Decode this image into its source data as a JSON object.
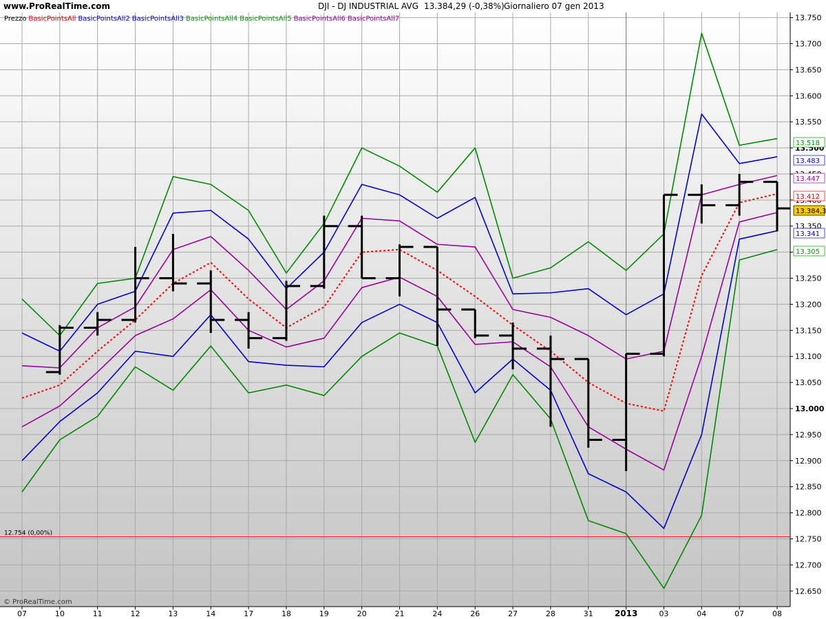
{
  "header": {
    "site": "www.ProRealTime.com",
    "instrument": "DJI - DJ INDUSTRIAL AVG",
    "price_change": "13.384,29 (-0,38%)",
    "period_date": "Giornaliero  07 gen 2013"
  },
  "watermark": "© ProRealTime.com",
  "legend_items": [
    {
      "text": "Prezzo",
      "color": "#000000"
    },
    {
      "text": "BasicPointsAll",
      "color": "#dd0000"
    },
    {
      "text": "BasicPointsAll2",
      "color": "#0000cc"
    },
    {
      "text": "BasicPointsAll3",
      "color": "#0000cc"
    },
    {
      "text": "BasicPointsAll4",
      "color": "#009900"
    },
    {
      "text": "BasicPointsAll5",
      "color": "#009900"
    },
    {
      "text": "BasicPointsAll6",
      "color": "#990099"
    },
    {
      "text": "BasicPointsAll7",
      "color": "#990099"
    }
  ],
  "chart_data": {
    "type": "line",
    "price_style": "ohlc-bars",
    "x_ticks": [
      "07",
      "10",
      "11",
      "12",
      "13",
      "14",
      "17",
      "18",
      "19",
      "20",
      "21",
      "24",
      "26",
      "27",
      "28",
      "31",
      "2013",
      "03",
      "04",
      "07",
      "08"
    ],
    "ylim": [
      12620,
      13760
    ],
    "y_ticks": [
      "13.750",
      "13.700",
      "13.650",
      "13.600",
      "13.550",
      "13.500",
      "13.450",
      "13.400",
      "13.350",
      "13.300",
      "13.250",
      "13.200",
      "13.150",
      "13.100",
      "13.050",
      "13.000",
      "12.950",
      "12.900",
      "12.850",
      "12.800",
      "12.750",
      "12.700",
      "12.650"
    ],
    "y_tick_values": [
      13750,
      13700,
      13650,
      13600,
      13550,
      13500,
      13450,
      13400,
      13350,
      13300,
      13250,
      13200,
      13150,
      13100,
      13050,
      13000,
      12950,
      12900,
      12850,
      12800,
      12750,
      12700,
      12650
    ],
    "bold_y_ticks": [
      "13.500",
      "13.000"
    ],
    "grid": true,
    "reference_line": {
      "value": 12754,
      "label": "12.754 (0,00%)",
      "color": "#ff0000"
    },
    "ohlc": [
      {
        "x": 1,
        "o": 13070,
        "h": 13160,
        "l": 13065,
        "c": 13155
      },
      {
        "x": 2,
        "o": 13155,
        "h": 13185,
        "l": 13140,
        "c": 13170
      },
      {
        "x": 3,
        "o": 13170,
        "h": 13310,
        "l": 13165,
        "c": 13250
      },
      {
        "x": 4,
        "o": 13250,
        "h": 13335,
        "l": 13225,
        "c": 13240
      },
      {
        "x": 5,
        "o": 13240,
        "h": 13265,
        "l": 13145,
        "c": 13170
      },
      {
        "x": 6,
        "o": 13170,
        "h": 13185,
        "l": 13115,
        "c": 13135
      },
      {
        "x": 7,
        "o": 13135,
        "h": 13245,
        "l": 13130,
        "c": 13235
      },
      {
        "x": 8,
        "o": 13235,
        "h": 13370,
        "l": 13230,
        "c": 13350
      },
      {
        "x": 9,
        "o": 13350,
        "h": 13370,
        "l": 13250,
        "c": 13250
      },
      {
        "x": 10,
        "o": 13250,
        "h": 13315,
        "l": 13215,
        "c": 13310
      },
      {
        "x": 11,
        "o": 13310,
        "h": 13310,
        "l": 13120,
        "c": 13190
      },
      {
        "x": 12,
        "o": 13190,
        "h": 13190,
        "l": 13135,
        "c": 13140
      },
      {
        "x": 13,
        "o": 13140,
        "h": 13165,
        "l": 13075,
        "c": 13115
      },
      {
        "x": 14,
        "o": 13115,
        "h": 13140,
        "l": 12965,
        "c": 13095
      },
      {
        "x": 15,
        "o": 13095,
        "h": 13095,
        "l": 12925,
        "c": 12940
      },
      {
        "x": 16,
        "o": 12940,
        "h": 13105,
        "l": 12880,
        "c": 13105
      },
      {
        "x": 17,
        "o": 13105,
        "h": 13410,
        "l": 13100,
        "c": 13410
      },
      {
        "x": 18,
        "o": 13410,
        "h": 13430,
        "l": 13355,
        "c": 13390
      },
      {
        "x": 19,
        "o": 13390,
        "h": 13450,
        "l": 13370,
        "c": 13435
      },
      {
        "x": 20,
        "o": 13435,
        "h": 13435,
        "l": 13340,
        "c": 13384
      }
    ],
    "series": [
      {
        "key": "BasicPointsAll",
        "color": "#ff0000",
        "dashed": true,
        "x": [
          0,
          1,
          2,
          3,
          4,
          5,
          6,
          7,
          8,
          9,
          10,
          11,
          12,
          13,
          14,
          15,
          16,
          17,
          18,
          19,
          20
        ],
        "values": [
          13020,
          13045,
          13110,
          13170,
          13240,
          13280,
          13210,
          13155,
          13195,
          13300,
          13305,
          13265,
          13215,
          13160,
          13110,
          13050,
          13010,
          12995,
          13255,
          13395,
          13412
        ]
      },
      {
        "key": "BasicPointsAll2",
        "color": "#0000cc",
        "x": [
          0,
          1,
          2,
          3,
          4,
          5,
          6,
          7,
          8,
          9,
          10,
          11,
          12,
          13,
          14,
          15,
          16,
          17,
          18,
          19,
          20
        ],
        "values": [
          13145,
          13110,
          13200,
          13225,
          13375,
          13380,
          13325,
          13230,
          13300,
          13430,
          13410,
          13365,
          13405,
          13220,
          13222,
          13230,
          13180,
          13220,
          13565,
          13470,
          13483
        ]
      },
      {
        "key": "BasicPointsAll3",
        "color": "#0000cc",
        "x": [
          0,
          1,
          2,
          3,
          4,
          5,
          6,
          7,
          8,
          9,
          10,
          11,
          12,
          13,
          14,
          15,
          16,
          17,
          18,
          19,
          20
        ],
        "values": [
          12900,
          12975,
          13030,
          13110,
          13100,
          13180,
          13090,
          13083,
          13080,
          13165,
          13200,
          13165,
          13030,
          13095,
          13035,
          12875,
          12840,
          12770,
          12950,
          13325,
          13341
        ]
      },
      {
        "key": "BasicPointsAll4",
        "color": "#008800",
        "x": [
          0,
          1,
          2,
          3,
          4,
          5,
          6,
          7,
          8,
          9,
          10,
          11,
          12,
          13,
          14,
          15,
          16,
          17,
          18,
          19,
          20
        ],
        "values": [
          13210,
          13140,
          13240,
          13250,
          13445,
          13430,
          13380,
          13260,
          13355,
          13500,
          13465,
          13415,
          13500,
          13250,
          13270,
          13320,
          13265,
          13335,
          13720,
          13505,
          13518
        ]
      },
      {
        "key": "BasicPointsAll5",
        "color": "#008800",
        "x": [
          0,
          1,
          2,
          3,
          4,
          5,
          6,
          7,
          8,
          9,
          10,
          11,
          12,
          13,
          14,
          15,
          16,
          17,
          18,
          19,
          20
        ],
        "values": [
          12840,
          12940,
          12985,
          13080,
          13035,
          13120,
          13030,
          13045,
          13025,
          13100,
          13145,
          13120,
          12935,
          13065,
          12980,
          12785,
          12760,
          12655,
          12795,
          13285,
          13305
        ]
      },
      {
        "key": "BasicPointsAll6",
        "color": "#990099",
        "x": [
          0,
          1,
          2,
          3,
          4,
          5,
          6,
          7,
          8,
          9,
          10,
          11,
          12,
          13,
          14,
          15,
          16,
          17,
          18,
          19,
          20
        ],
        "values": [
          13082,
          13078,
          13155,
          13195,
          13305,
          13330,
          13265,
          13190,
          13245,
          13365,
          13360,
          13315,
          13310,
          13190,
          13175,
          13140,
          13095,
          13110,
          13410,
          13430,
          13447
        ]
      },
      {
        "key": "BasicPointsAll7",
        "color": "#990099",
        "x": [
          0,
          1,
          2,
          3,
          4,
          5,
          6,
          7,
          8,
          9,
          10,
          11,
          12,
          13,
          14,
          15,
          16,
          17,
          18,
          19,
          20
        ],
        "values": [
          12965,
          13005,
          13070,
          13140,
          13172,
          13228,
          13150,
          13118,
          13135,
          13232,
          13252,
          13215,
          13123,
          13128,
          13080,
          12965,
          12922,
          12882,
          13100,
          13358,
          13376
        ]
      }
    ],
    "price_labels": [
      {
        "text": "13.518",
        "value": 13518,
        "color": "#009900",
        "bg": "#ffffff"
      },
      {
        "text": "13.483",
        "value": 13483,
        "color": "#0000cc",
        "bg": "#ffffff"
      },
      {
        "text": "13.447",
        "value": 13447,
        "color": "#990099",
        "bg": "#ffffff"
      },
      {
        "text": "13.412",
        "value": 13412,
        "color": "#dd0000",
        "bg": "#ffffff"
      },
      {
        "text": "13.384,3",
        "value": 13384,
        "color": "#000000",
        "bg": "#ffcc00"
      },
      {
        "text": "13.341",
        "value": 13341,
        "color": "#0000cc",
        "bg": "#ffffff"
      },
      {
        "text": "13.305",
        "value": 13305,
        "color": "#009900",
        "bg": "#ffffff"
      }
    ]
  }
}
